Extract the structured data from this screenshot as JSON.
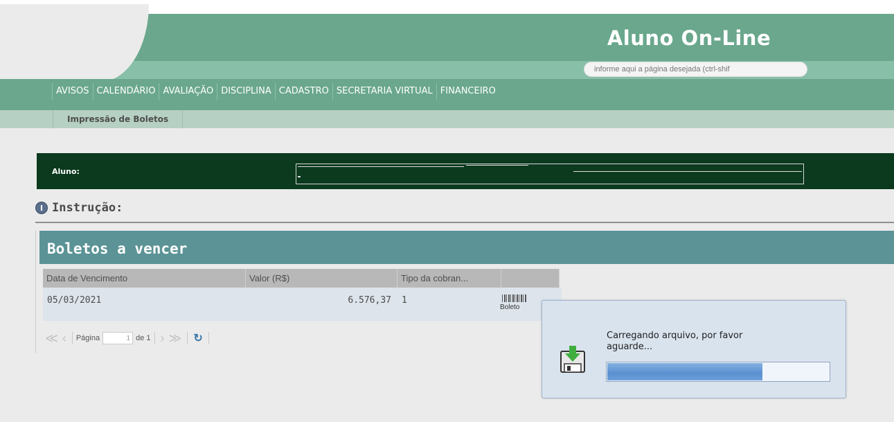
{
  "header": {
    "app_title": "Aluno On-Line",
    "search_placeholder": "informe aqui a página desejada (ctrl-shif"
  },
  "menu": {
    "items": [
      "AVISOS",
      "CALENDÁRIO",
      "AVALIAÇÃO",
      "DISCIPLINA",
      "CADASTRO",
      "SECRETARIA VIRTUAL",
      "FINANCEIRO"
    ],
    "sub_item": "Impressão de Boletos"
  },
  "student": {
    "label": "Aluno:"
  },
  "instruction": {
    "label": "Instrução:"
  },
  "panel": {
    "title": "Boletos a vencer",
    "columns": [
      "Data de Vencimento",
      "Valor (R$)",
      "Tipo da cobran...",
      ""
    ],
    "rows": [
      {
        "due_date": "05/03/2021",
        "value": "6.576,37",
        "type": "1",
        "action": "Boleto"
      }
    ]
  },
  "pager": {
    "page_label": "Página",
    "current_page": "1",
    "of_label": "de 1"
  },
  "loading": {
    "message": "Carregando arquivo, por favor aguarde...",
    "progress": 0.7
  },
  "colors": {
    "header_green": "#6aa78d",
    "student_bar": "#0b3a1e",
    "panel_header": "#5b9396",
    "progress_blue": "#5a8fd0"
  }
}
